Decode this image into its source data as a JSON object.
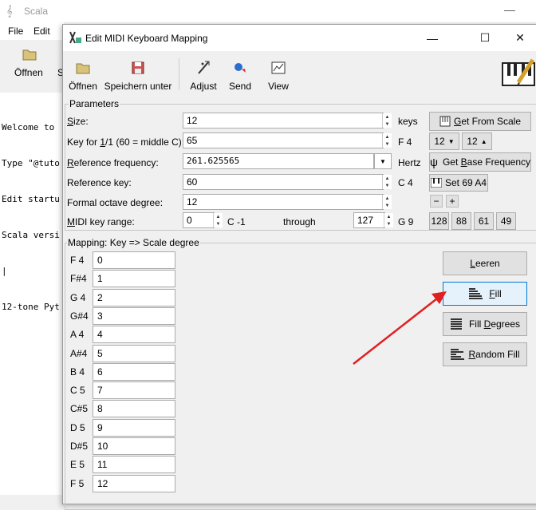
{
  "background_window": {
    "title": "Scala",
    "menu": [
      "File",
      "Edit"
    ],
    "toolbar_first_label": "Öffnen",
    "console_lines": [
      "Welcome to",
      "Type \"@tuto",
      "Edit startu",
      "Scala versi",
      "|",
      "12-tone Pyt"
    ]
  },
  "dialog": {
    "title": "Edit MIDI Keyboard Mapping",
    "toolbar": {
      "open": "Öffnen",
      "save_as": "Speichern unter",
      "adjust": "Adjust",
      "send": "Send",
      "view": "View"
    },
    "parameters": {
      "group_label": "Parameters",
      "size_label": "Size:",
      "size_value": "12",
      "size_unit": "keys",
      "key_label": "Key for 1/1 (60 = middle C):",
      "key_value": "65",
      "key_note": "F 4",
      "ref_freq_label": "Reference frequency:",
      "ref_freq_value": "261.625565",
      "ref_freq_unit": "Hertz",
      "ref_key_label": "Reference key:",
      "ref_key_value": "60",
      "ref_key_note": "C 4",
      "octave_label": "Formal octave degree:",
      "octave_value": "12",
      "range_label": "MIDI key range:",
      "range_from": "0",
      "range_from_note": "C -1",
      "range_through": "through",
      "range_to": "127",
      "range_to_note": "G 9",
      "get_from_scale": "Get From Scale",
      "dec_value": "12",
      "inc_value": "12",
      "get_base_freq": "Get Base Frequency",
      "set_69": "Set 69 A4",
      "minus": "−",
      "plus": "+",
      "range_presets": [
        "128",
        "88",
        "61",
        "49"
      ]
    },
    "mapping": {
      "group_label": "Mapping: Key => Scale degree",
      "rows": [
        {
          "key": "F 4",
          "degree": "0"
        },
        {
          "key": "F#4",
          "degree": "1"
        },
        {
          "key": "G 4",
          "degree": "2"
        },
        {
          "key": "G#4",
          "degree": "3"
        },
        {
          "key": "A 4",
          "degree": "4"
        },
        {
          "key": "A#4",
          "degree": "5"
        },
        {
          "key": "B 4",
          "degree": "6"
        },
        {
          "key": "C 5",
          "degree": "7"
        },
        {
          "key": "C#5",
          "degree": "8"
        },
        {
          "key": "D 5",
          "degree": "9"
        },
        {
          "key": "D#5",
          "degree": "10"
        },
        {
          "key": "E 5",
          "degree": "11"
        },
        {
          "key": "F 5",
          "degree": "12"
        }
      ],
      "buttons": {
        "clear": "Leeren",
        "fill": "Fill",
        "fill_degrees": "Fill Degrees",
        "random_fill": "Random Fill"
      }
    }
  },
  "colors": {
    "annotation_arrow": "#e02020",
    "focus_border": "#0078d7"
  }
}
